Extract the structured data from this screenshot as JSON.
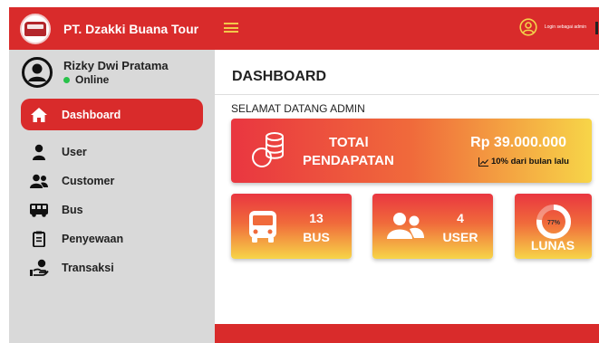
{
  "brand": {
    "name": "PT. Dzakki Buana Tour",
    "logo": "bus-logo"
  },
  "user": {
    "name": "Rizky Dwi Pratama",
    "status": "Online",
    "status_color": "#28c24a"
  },
  "nav": [
    {
      "label": "Dashboard",
      "icon": "home-icon",
      "active": true
    },
    {
      "label": "User",
      "icon": "user-icon",
      "active": false
    },
    {
      "label": "Customer",
      "icon": "users-icon",
      "active": false
    },
    {
      "label": "Bus",
      "icon": "bus-icon",
      "active": false
    },
    {
      "label": "Penyewaan",
      "icon": "clipboard-icon",
      "active": false
    },
    {
      "label": "Transaksi",
      "icon": "hand-coin-icon",
      "active": false
    }
  ],
  "topbar": {
    "login_text": "Login sebagai admin",
    "menu_icon": "hamburger-icon",
    "account_icon": "user-circle-icon"
  },
  "page": {
    "title": "DASHBOARD",
    "welcome": "SELAMAT DATANG ADMIN"
  },
  "cards": {
    "total": {
      "label_line1": "TOTAl",
      "label_line2": "PENDAPATAN",
      "amount": "Rp 39.000.000",
      "growth": "10% dari bulan lalu"
    },
    "bus": {
      "count": "13",
      "label": "BUS"
    },
    "user": {
      "count": "4",
      "label": "USER"
    },
    "lunas": {
      "percent_text": "77%",
      "percent_value": 77,
      "label": "LUNAS"
    }
  },
  "colors": {
    "primary": "#d92b2b",
    "sidebar": "#d9d9d9",
    "gradient_start": "#e93640",
    "gradient_end": "#f7d548",
    "hamburger": "#f3c74a"
  }
}
